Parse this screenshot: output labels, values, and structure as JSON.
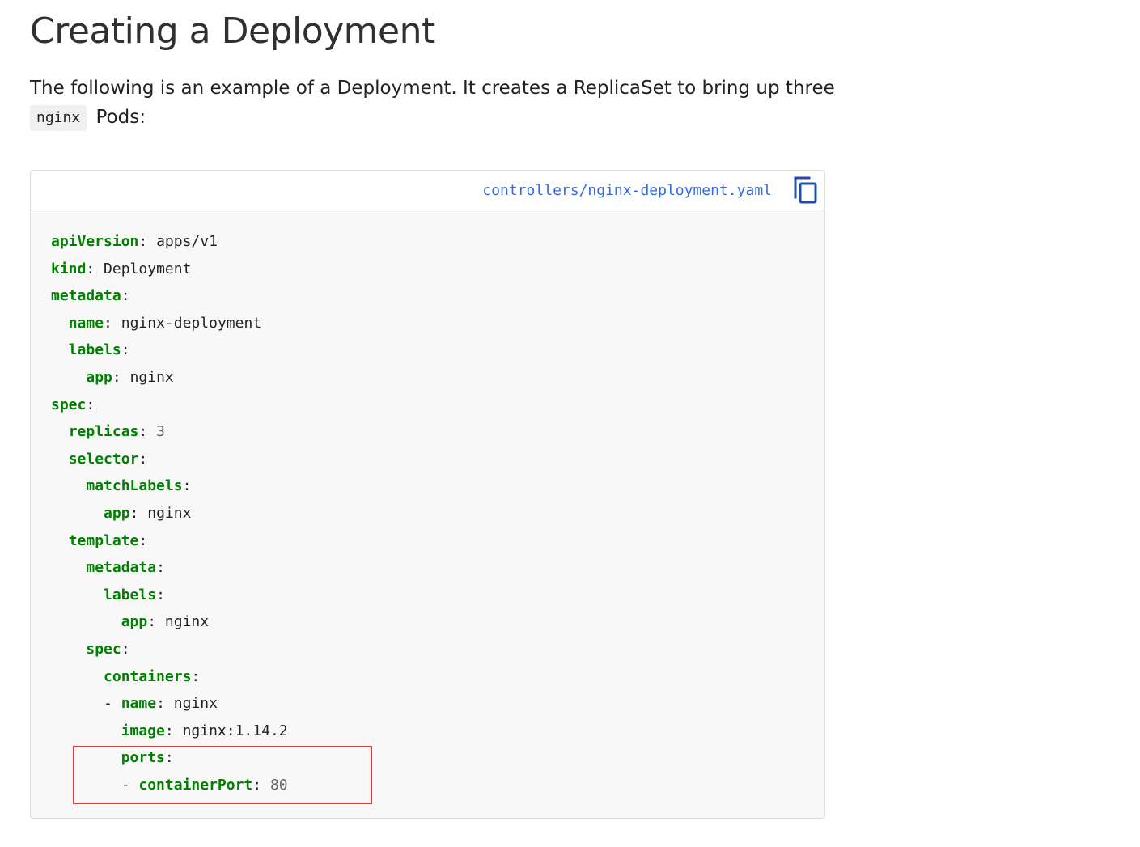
{
  "page": {
    "title": "Creating a Deployment",
    "intro_line1": "The following is an example of a Deployment. It creates a ReplicaSet to bring up three",
    "intro_code": "nginx",
    "intro_tail": "Pods:"
  },
  "code_block": {
    "file_name": "controllers/nginx-deployment.yaml",
    "copy_icon": "copy-icon",
    "lines": [
      {
        "indent": "",
        "key": "apiVersion",
        "value": "apps/v1",
        "value_type": "str"
      },
      {
        "indent": "",
        "key": "kind",
        "value": "Deployment",
        "value_type": "str"
      },
      {
        "indent": "",
        "key": "metadata",
        "value": "",
        "value_type": "str"
      },
      {
        "indent": "  ",
        "key": "name",
        "value": "nginx-deployment",
        "value_type": "str"
      },
      {
        "indent": "  ",
        "key": "labels",
        "value": "",
        "value_type": "str"
      },
      {
        "indent": "    ",
        "key": "app",
        "value": "nginx",
        "value_type": "str"
      },
      {
        "indent": "",
        "key": "spec",
        "value": "",
        "value_type": "str"
      },
      {
        "indent": "  ",
        "key": "replicas",
        "value": "3",
        "value_type": "num"
      },
      {
        "indent": "  ",
        "key": "selector",
        "value": "",
        "value_type": "str"
      },
      {
        "indent": "    ",
        "key": "matchLabels",
        "value": "",
        "value_type": "str"
      },
      {
        "indent": "      ",
        "key": "app",
        "value": "nginx",
        "value_type": "str"
      },
      {
        "indent": "  ",
        "key": "template",
        "value": "",
        "value_type": "str"
      },
      {
        "indent": "    ",
        "key": "metadata",
        "value": "",
        "value_type": "str"
      },
      {
        "indent": "      ",
        "key": "labels",
        "value": "",
        "value_type": "str"
      },
      {
        "indent": "        ",
        "key": "app",
        "value": "nginx",
        "value_type": "str"
      },
      {
        "indent": "    ",
        "key": "spec",
        "value": "",
        "value_type": "str"
      },
      {
        "indent": "      ",
        "key": "containers",
        "value": "",
        "value_type": "str"
      },
      {
        "indent": "      - ",
        "key": "name",
        "value": "nginx",
        "value_type": "str"
      },
      {
        "indent": "        ",
        "key": "image",
        "value": "nginx:1.14.2",
        "value_type": "str"
      },
      {
        "indent": "        ",
        "key": "ports",
        "value": "",
        "value_type": "str"
      },
      {
        "indent": "        - ",
        "key": "containerPort",
        "value": "80",
        "value_type": "num"
      }
    ]
  },
  "colors": {
    "key": "#008000",
    "number": "#666666",
    "link": "#326ce5",
    "highlight": "#e53935",
    "copy_icon": "#1e4fa8"
  }
}
